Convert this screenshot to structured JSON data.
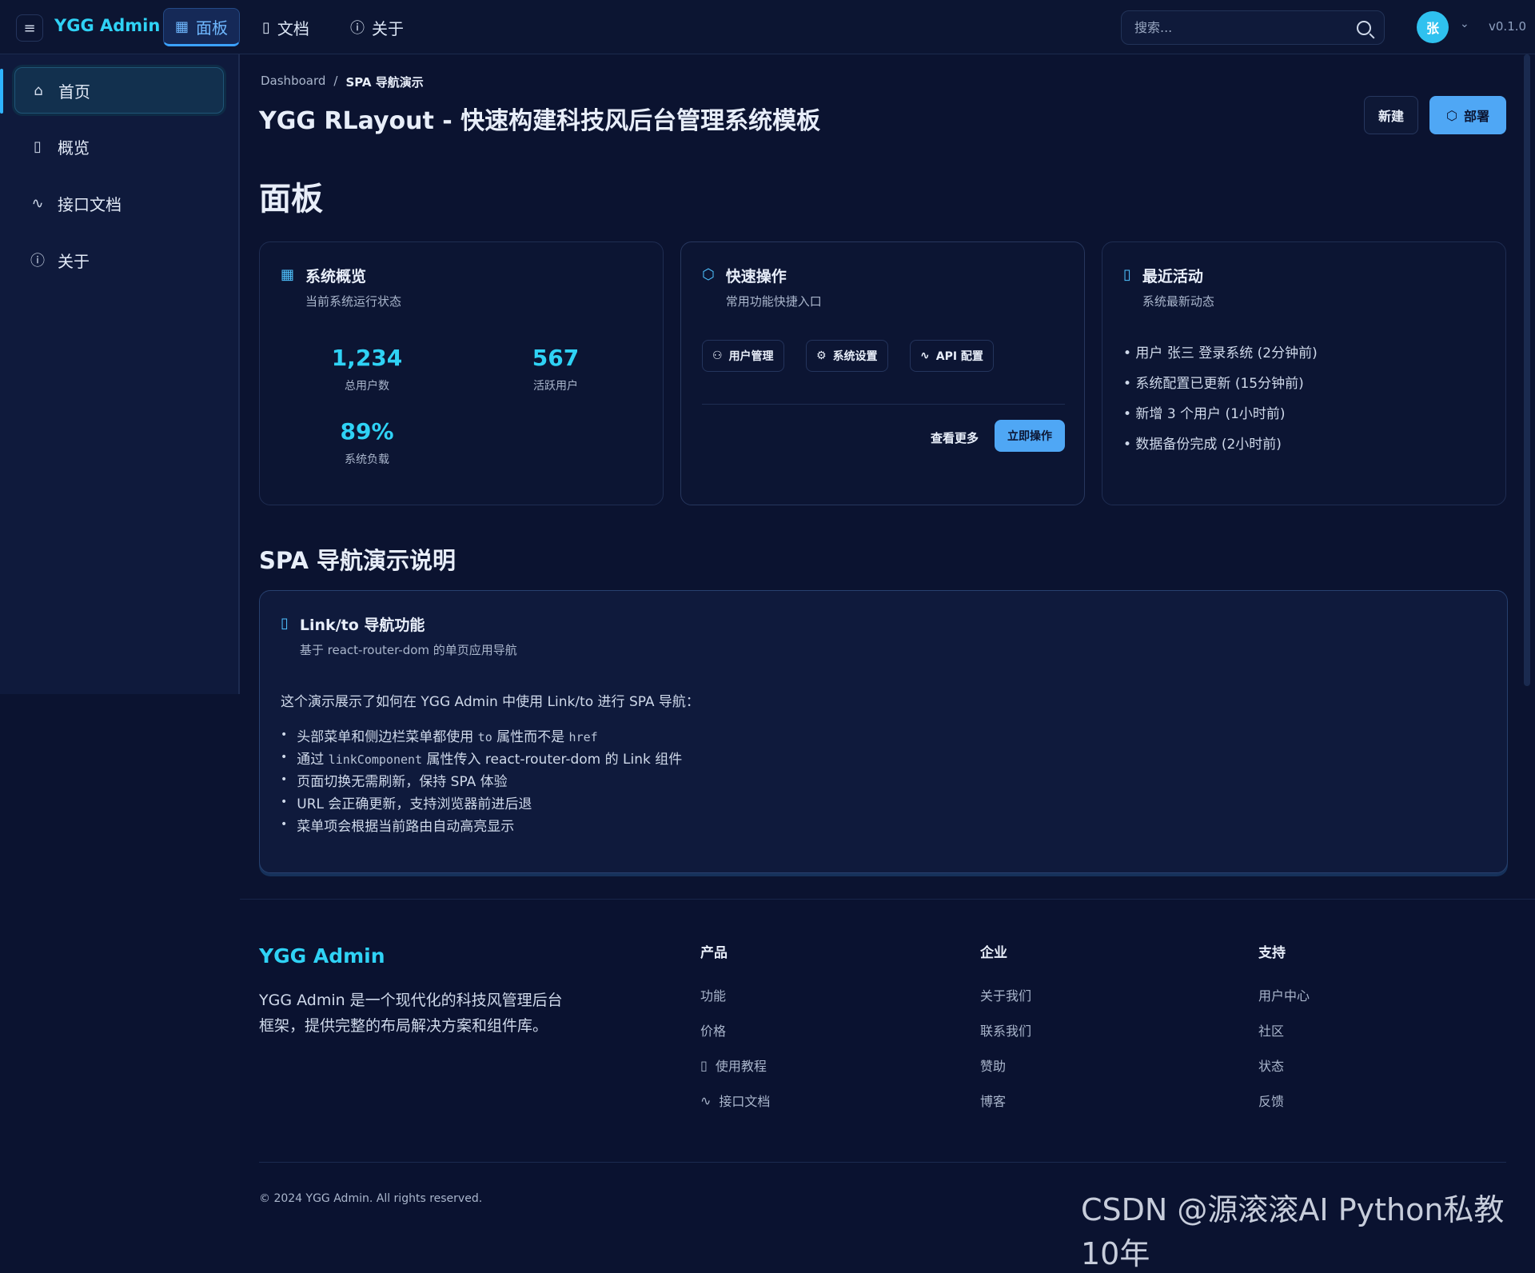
{
  "header": {
    "logo": "YGG Admin",
    "nav": [
      {
        "label": "面板",
        "icon": "dashboard-icon",
        "active": true
      },
      {
        "label": "文档",
        "icon": "book-icon",
        "active": false
      },
      {
        "label": "关于",
        "icon": "info-icon",
        "active": false
      }
    ],
    "search_placeholder": "搜索...",
    "avatar_initial": "张",
    "version": "v0.1.0"
  },
  "sidebar": {
    "items": [
      {
        "label": "首页",
        "icon": "home-icon",
        "active": true
      },
      {
        "label": "概览",
        "icon": "document-icon",
        "active": false
      },
      {
        "label": "接口文档",
        "icon": "activity-icon",
        "active": false
      },
      {
        "label": "关于",
        "icon": "info-icon",
        "active": false
      }
    ]
  },
  "main": {
    "breadcrumb": [
      "Dashboard",
      "SPA 导航演示"
    ],
    "title": "YGG RLayout - 快速构建科技风后台管理系统模板",
    "new_button": "新建",
    "deploy_button": "部署",
    "section_title": "面板",
    "cards": {
      "overview": {
        "title": "系统概览",
        "subtitle": "当前系统运行状态",
        "stats": [
          {
            "value": "1,234",
            "label": "总用户数"
          },
          {
            "value": "567",
            "label": "活跃用户"
          },
          {
            "value": "89%",
            "label": "系统负载"
          }
        ]
      },
      "quick": {
        "title": "快速操作",
        "subtitle": "常用功能快捷入口",
        "actions": [
          "用户管理",
          "系统设置",
          "API 配置"
        ],
        "more": "查看更多",
        "primary": "立即操作"
      },
      "activity": {
        "title": "最近活动",
        "subtitle": "系统最新动态",
        "items": [
          "• 用户 张三 登录系统 (2分钟前)",
          "• 系统配置已更新 (15分钟前)",
          "• 新增 3 个用户 (1小时前)",
          "• 数据备份完成 (2小时前)"
        ]
      }
    },
    "spa_section_title": "SPA 导航演示说明",
    "spa_card": {
      "title": "Link/to 导航功能",
      "subtitle": "基于 react-router-dom 的单页应用导航",
      "intro": "这个演示展示了如何在 YGG Admin 中使用 Link/to 进行 SPA 导航：",
      "bullet1_a": "头部菜单和侧边栏菜单都使用",
      "bullet1_code1": "to",
      "bullet1_b": "属性而不是",
      "bullet1_code2": "href",
      "bullet2_a": "通过",
      "bullet2_code": "linkComponent",
      "bullet2_b": "属性传入 react-router-dom 的 Link 组件",
      "bullet3": "页面切换无需刷新，保持 SPA 体验",
      "bullet4": "URL 会正确更新，支持浏览器前进后退",
      "bullet5": "菜单项会根据当前路由自动高亮显示"
    }
  },
  "footer": {
    "logo": "YGG Admin",
    "description": "YGG Admin 是一个现代化的科技风管理后台框架，提供完整的布局解决方案和组件库。",
    "columns": [
      {
        "title": "产品",
        "links": [
          "功能",
          "价格",
          "使用教程",
          "接口文档"
        ]
      },
      {
        "title": "企业",
        "links": [
          "关于我们",
          "联系我们",
          "赞助",
          "博客"
        ]
      },
      {
        "title": "支持",
        "links": [
          "用户中心",
          "社区",
          "状态",
          "反馈"
        ]
      }
    ],
    "copyright": "© 2024 YGG Admin. All rights reserved."
  },
  "watermark": "CSDN @源滚滚AI Python私教10年",
  "colors": {
    "accent": "#2fd2f5",
    "primary_button": "#4fa7f5",
    "background": "#0b1330"
  }
}
